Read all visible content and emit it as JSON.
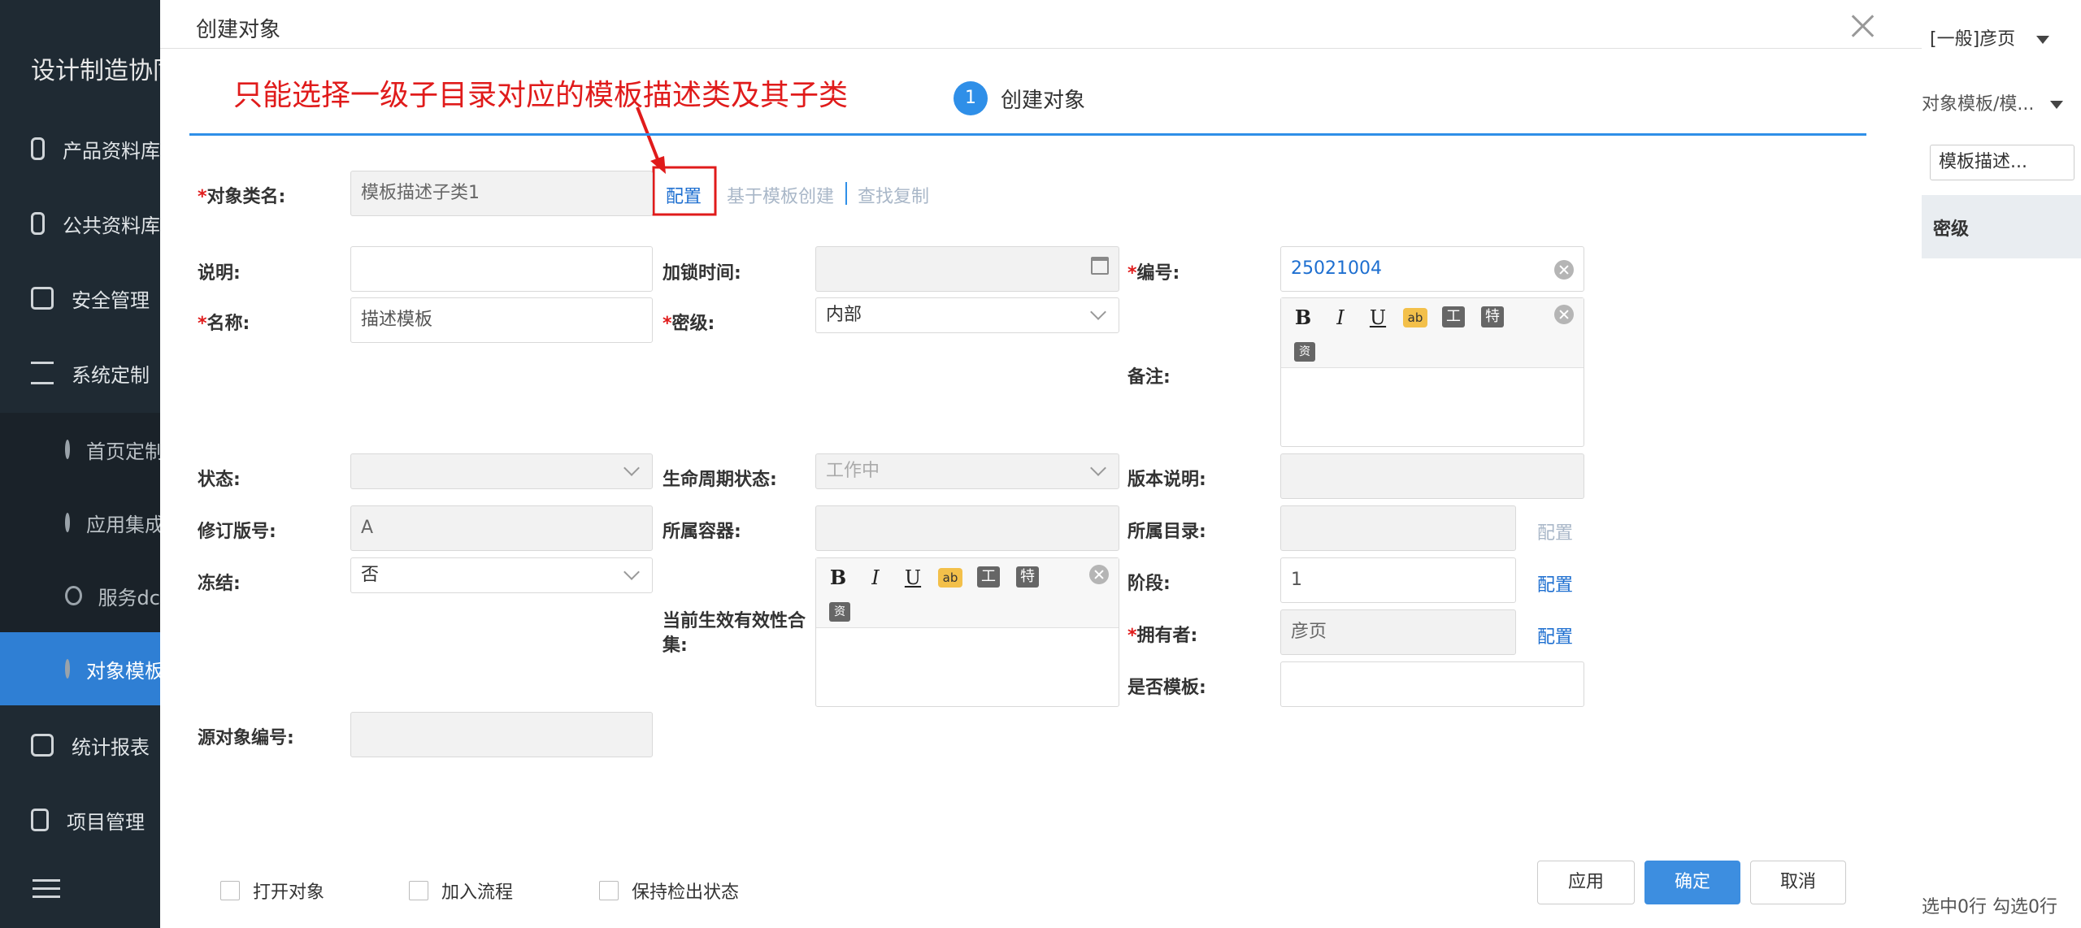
{
  "app": {
    "title": "设计制造协同"
  },
  "sidebar": {
    "items": [
      {
        "label": "产品资料库"
      },
      {
        "label": "公共资料库"
      },
      {
        "label": "安全管理"
      },
      {
        "label": "系统定制"
      },
      {
        "label": "首页定制"
      },
      {
        "label": "应用集成"
      },
      {
        "label": "服务dc"
      },
      {
        "label": "对象模板"
      },
      {
        "label": "统计报表"
      },
      {
        "label": "项目管理"
      }
    ]
  },
  "rightpanel": {
    "user": "[一般]彦页",
    "breadcrumb": "对象模板/模...",
    "select_value": "模板描述...",
    "column_header": "密级",
    "footer": "选中0行   勾选0行"
  },
  "dialog": {
    "title": "创建对象",
    "annotation": "只能选择一级子目录对应的模板描述类及其子类",
    "step": {
      "number": "1",
      "label": "创建对象"
    },
    "fields": {
      "object_class": {
        "label": "对象类名:",
        "value": "模板描述子类1",
        "config": "配置",
        "from_template": "基于模板创建",
        "find_copy": "查找复制"
      },
      "description": {
        "label": "说明:",
        "value": ""
      },
      "lock_time": {
        "label": "加锁时间:",
        "value": ""
      },
      "number": {
        "label": "编号:",
        "value": "25021004"
      },
      "name": {
        "label": "名称:",
        "value": "描述模板"
      },
      "security": {
        "label": "密级:",
        "value": "内部"
      },
      "remark": {
        "label": "备注:"
      },
      "status": {
        "label": "状态:",
        "value": ""
      },
      "lifecycle": {
        "label": "生命周期状态:",
        "value": "工作中"
      },
      "version_note": {
        "label": "版本说明:",
        "value": ""
      },
      "revision": {
        "label": "修订版号:",
        "value": "A"
      },
      "container": {
        "label": "所属容器:",
        "value": ""
      },
      "directory": {
        "label": "所属目录:",
        "value": "",
        "config": "配置"
      },
      "frozen": {
        "label": "冻结:",
        "value": "否"
      },
      "phase": {
        "label": "阶段:",
        "value": "1",
        "config": "配置"
      },
      "effectivity": {
        "label": "当前生效有效性合集:"
      },
      "owner": {
        "label": "拥有者:",
        "value": "彦页",
        "config": "配置"
      },
      "is_template": {
        "label": "是否模板:",
        "value": ""
      },
      "source_number": {
        "label": "源对象编号:",
        "value": ""
      }
    },
    "required_mark": "*",
    "toolbar": {
      "bold": "B",
      "italic": "I",
      "underline": "U",
      "spell": "ab",
      "text": "工",
      "special": "特",
      "resource": "资"
    },
    "checkboxes": {
      "open": "打开对象",
      "workflow": "加入流程",
      "keep_checkout": "保持检出状态"
    },
    "buttons": {
      "apply": "应用",
      "ok": "确定",
      "cancel": "取消"
    }
  },
  "colors": {
    "accent": "#2f8fe8",
    "annotation": "#e01b1b",
    "sidebar": "#1f2a33",
    "sidebar_active": "#2f7fd4"
  }
}
